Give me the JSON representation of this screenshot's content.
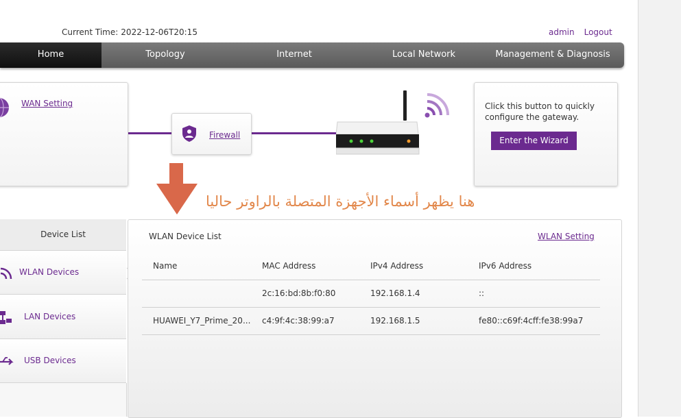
{
  "header": {
    "time_label": "Current Time:",
    "time_value": "2022-12-06T20:15",
    "admin": "admin",
    "logout": "Logout"
  },
  "nav": {
    "items": [
      {
        "label": "Home",
        "active": true
      },
      {
        "label": "Topology"
      },
      {
        "label": "Internet"
      },
      {
        "label": "Local Network"
      },
      {
        "label": "Management & Diagnosis"
      }
    ]
  },
  "topology": {
    "wan_setting": "WAN Setting",
    "firewall": "Firewall",
    "wizard_hint": "Click this button to quickly configure the gateway.",
    "wizard_button": "Enter the Wizard"
  },
  "annotation": "هنا يظهر أسماء الأجهزة المتصلة بالراوتر حاليا",
  "sidebar": {
    "title": "Device List",
    "items": [
      {
        "label": "WLAN Devices",
        "icon": "wifi-icon"
      },
      {
        "label": "LAN Devices",
        "icon": "network-icon"
      },
      {
        "label": "USB Devices",
        "icon": "usb-icon"
      }
    ]
  },
  "panel": {
    "title": "WLAN Device List",
    "wlan_setting": "WLAN Setting",
    "columns": [
      "Name",
      "MAC Address",
      "IPv4 Address",
      "IPv6 Address"
    ],
    "rows": [
      {
        "name": "",
        "mac": "2c:16:bd:8b:f0:80",
        "ipv4": "192.168.1.4",
        "ipv6": "::"
      },
      {
        "name": "HUAWEI_Y7_Prime_20...",
        "mac": "c4:9f:4c:38:99:a7",
        "ipv4": "192.168.1.5",
        "ipv6": "fe80::c69f:4cff:fe38:99a7"
      }
    ]
  },
  "colors": {
    "accent": "#6b2a8f",
    "annotation": "#e2874a",
    "arrow": "#d9684a",
    "nav_bg": "#666666"
  }
}
